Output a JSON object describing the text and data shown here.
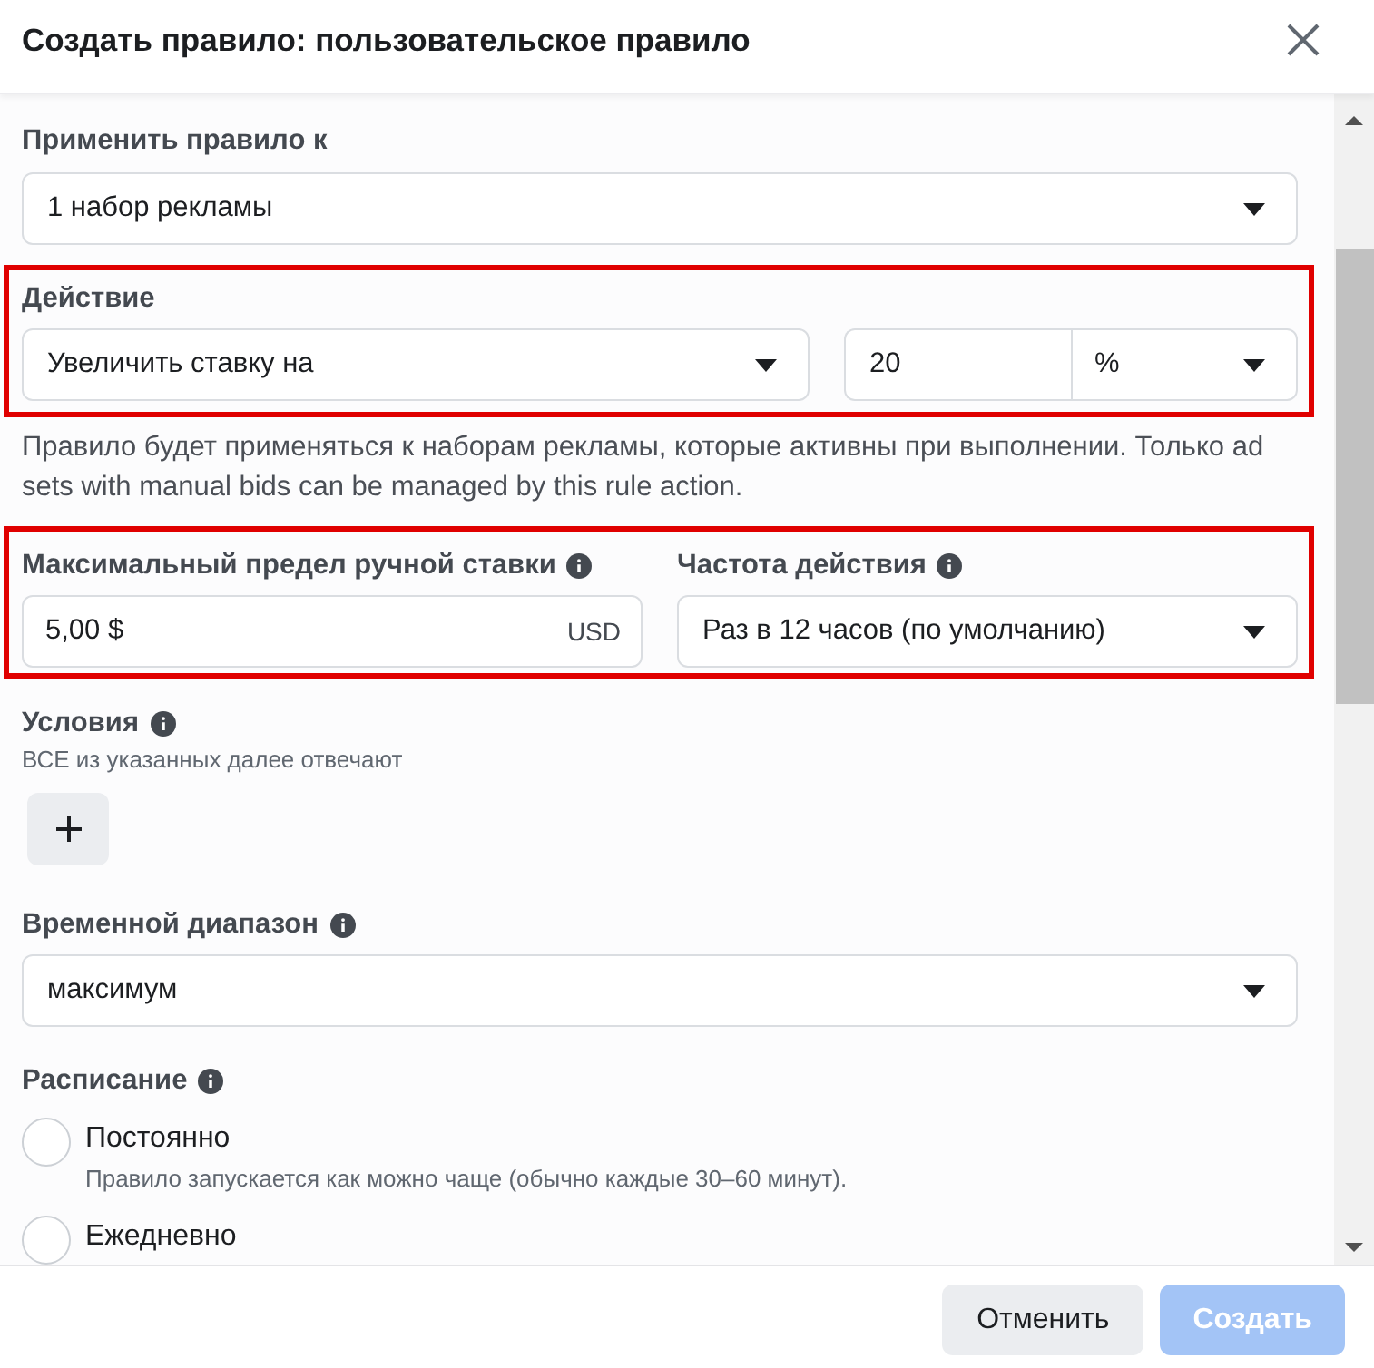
{
  "dialog": {
    "title": "Создать правило: пользовательское правило"
  },
  "apply_to": {
    "label": "Применить правило к",
    "value": "1 набор рекламы"
  },
  "action": {
    "highlighted": true,
    "label": "Действие",
    "value": "Увеличить ставку на",
    "amount": "20",
    "unit": "%"
  },
  "action_note": "Правило будет применяться к наборам рекламы, которые активны при выполнении. Только ad sets with manual bids can be managed by this rule action.",
  "limits": {
    "highlighted": true,
    "max_bid": {
      "label": "Максимальный предел ручной ставки",
      "info": true,
      "value": "5,00 $",
      "currency": "USD"
    },
    "frequency": {
      "label": "Частота действия",
      "info": true,
      "value": "Раз в 12 часов (по умолчанию)"
    }
  },
  "conditions": {
    "label": "Условия",
    "info": true,
    "subtitle": "ВСЕ из указанных далее отвечают"
  },
  "time_range": {
    "label": "Временной диапазон",
    "info": true,
    "value": "максимум"
  },
  "schedule": {
    "label": "Расписание",
    "info": true,
    "options": [
      {
        "label": "Постоянно",
        "description": "Правило запускается как можно чаще (обычно каждые 30–60 минут).",
        "selected": false
      },
      {
        "label": "Ежедневно",
        "selected": false
      }
    ]
  },
  "footer": {
    "buttons": [
      {
        "label": "Отменить",
        "kind": "secondary",
        "disabled": false
      },
      {
        "label": "Создать",
        "kind": "primary",
        "disabled": true
      }
    ]
  }
}
